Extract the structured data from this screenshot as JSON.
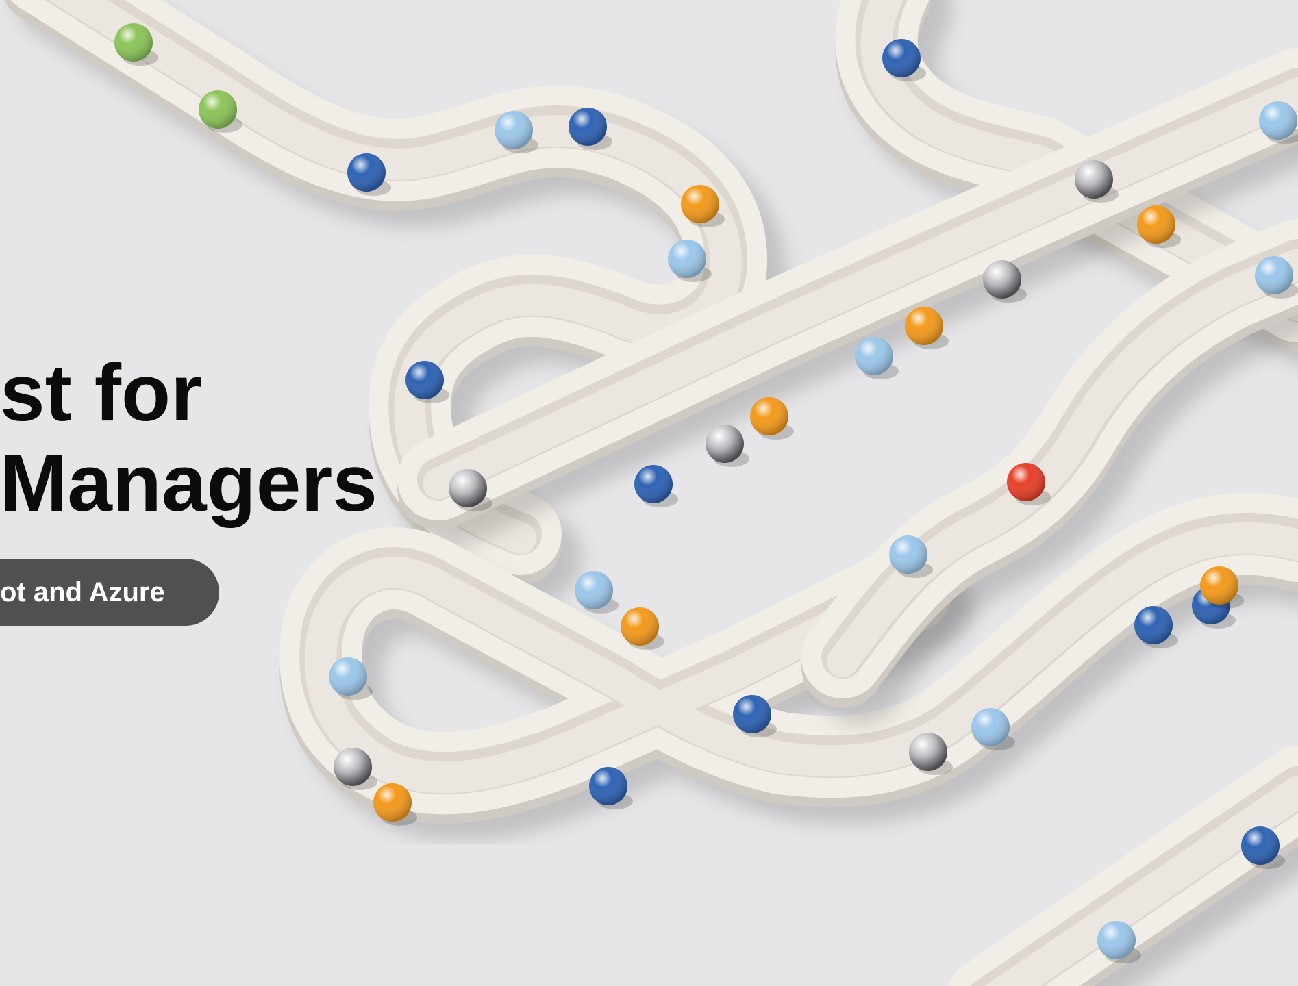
{
  "slide": {
    "title_line_1": "st for",
    "title_line_2": "Managers",
    "subtitle": "ot and Azure"
  },
  "illustration": {
    "subject": "marble-run-tracks",
    "colors": {
      "background": "#e6e6e8",
      "track": "#f1ede7",
      "dark_blue": "#2f63b4",
      "light_blue": "#9cc7ea",
      "orange": "#f39a1c",
      "green": "#8cc45a",
      "red": "#e8402a",
      "silver": "#b8b8bc"
    }
  }
}
